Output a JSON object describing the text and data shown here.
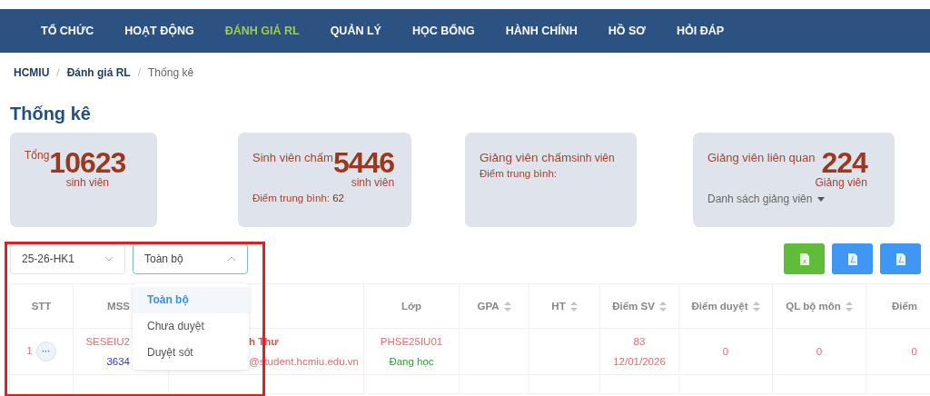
{
  "nav": {
    "items": [
      {
        "label": "TỔ CHỨC",
        "selected": false
      },
      {
        "label": "HOẠT ĐỘNG",
        "selected": false
      },
      {
        "label": "ĐÁNH GIÁ RL",
        "selected": true
      },
      {
        "label": "QUẢN LÝ",
        "selected": false
      },
      {
        "label": "HỌC BỔNG",
        "selected": false
      },
      {
        "label": "HÀNH CHÍNH",
        "selected": false
      },
      {
        "label": "HỒ SƠ",
        "selected": false
      },
      {
        "label": "HỎI ĐÁP",
        "selected": false
      }
    ]
  },
  "breadcrumb_separator": "/",
  "breadcrumb": [
    {
      "label": "HCMIU",
      "current": false
    },
    {
      "label": "Đánh giá RL",
      "current": false
    },
    {
      "label": "Thống kê",
      "current": true
    }
  ],
  "title": "Thống kê",
  "cards": [
    {
      "label": "Tổng",
      "value": "10623",
      "unit": "sinh viên"
    },
    {
      "label": "Sinh viên chấm",
      "value": "5446",
      "unit": "sinh viên",
      "note": "Điểm trung bình: ",
      "note_value": "62"
    },
    {
      "label": "Giảng viên chấm",
      "unit": "sinh viên",
      "note": "Điểm trung bình:"
    },
    {
      "label": "Giảng viên liên quan",
      "value": "224",
      "unit": "Giảng viên",
      "menu": "Danh sách giảng viên"
    }
  ],
  "filters": {
    "term": {
      "value": "25-26-HK1",
      "expanded": false
    },
    "status": {
      "value": "Toàn bộ",
      "expanded": true,
      "options": [
        {
          "label": "Toàn bộ",
          "selected": true
        },
        {
          "label": "Chưa duyệt",
          "selected": false
        },
        {
          "label": "Duyệt sót",
          "selected": false
        }
      ]
    }
  },
  "export_buttons": [
    {
      "kind": "excel",
      "glyph": "x"
    },
    {
      "kind": "pdf"
    },
    {
      "kind": "pdf"
    }
  ],
  "table": {
    "columns": [
      {
        "label": "STT",
        "sortable": false
      },
      {
        "label": "MSS",
        "sortable": false
      },
      {},
      {
        "label": "Lớp",
        "sortable": false
      },
      {
        "label": "GPA",
        "sortable": true
      },
      {
        "label": "HT",
        "sortable": true
      },
      {
        "label": "Điểm SV",
        "sortable": true
      },
      {
        "label": "Điểm duyệt",
        "sortable": true
      },
      {
        "label": "QL bộ môn",
        "sortable": true
      },
      {
        "label": "Điểm",
        "sortable": false
      }
    ],
    "rows": [
      {
        "cells": [
          [
            {
              "text": "1",
              "kind": "index"
            },
            {
              "text": "···",
              "kind": "more"
            }
          ],
          [
            {
              "text": "SESEIU2",
              "kind": "accent"
            },
            {
              "text": "3634",
              "kind": "link"
            }
          ],
          [
            {
              "text": "h Thư",
              "kind": "strong"
            },
            {
              "text": "@student.hcmiu.edu.vn",
              "kind": "accent"
            }
          ],
          [
            {
              "text": "PHSE25IU01",
              "kind": "accent"
            },
            {
              "text": "Đang học",
              "kind": "ok"
            }
          ],
          [],
          [],
          [
            {
              "text": "83",
              "kind": "accent"
            },
            {
              "text": "12/01/2026",
              "kind": "accent"
            }
          ],
          [
            {
              "text": "0",
              "kind": "accent"
            }
          ],
          [
            {
              "text": "0",
              "kind": "accent"
            }
          ],
          [
            {
              "text": "0",
              "kind": "accent"
            }
          ]
        ]
      }
    ]
  }
}
